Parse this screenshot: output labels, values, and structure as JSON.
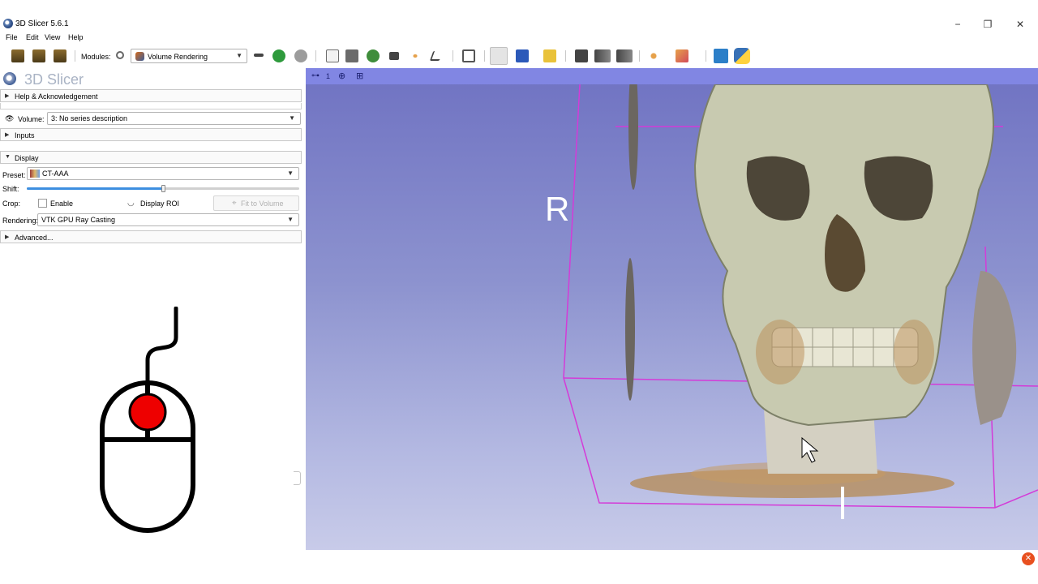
{
  "window": {
    "title": "3D Slicer 5.6.1",
    "minimize_icon": "−",
    "restore_icon": "❐",
    "close_icon": "✕"
  },
  "menu": [
    "File",
    "Edit",
    "View",
    "Help"
  ],
  "toolbar": {
    "modules_label": "Modules:",
    "module_selected": "Volume Rendering"
  },
  "panel": {
    "logo_text": "3D Slicer",
    "help_section": "Help & Acknowledgement",
    "volume_label": "Volume:",
    "volume_value": "3: No series description",
    "inputs_section": "Inputs",
    "display_section": "Display",
    "preset_label": "Preset:",
    "preset_value": "CT-AAA",
    "shift_label": "Shift:",
    "shift_fraction": 0.5,
    "crop_label": "Crop:",
    "enable_label": "Enable",
    "display_roi_label": "Display ROI",
    "fit_to_volume_label": "Fit to Volume",
    "rendering_label": "Rendering:",
    "rendering_value": "VTK GPU Ray Casting",
    "advanced_section": "Advanced..."
  },
  "viewer": {
    "view_number": "1",
    "orientation_right": "R"
  },
  "colors": {
    "viewer_bar": "#8186e3",
    "viewer_bg_top": "#6f72c2",
    "viewer_bg_bottom": "#c8cbe9",
    "roi_box": "#d43bd8",
    "slider_fill": "#3d8fe0",
    "mouse_button": "#ee0000"
  }
}
